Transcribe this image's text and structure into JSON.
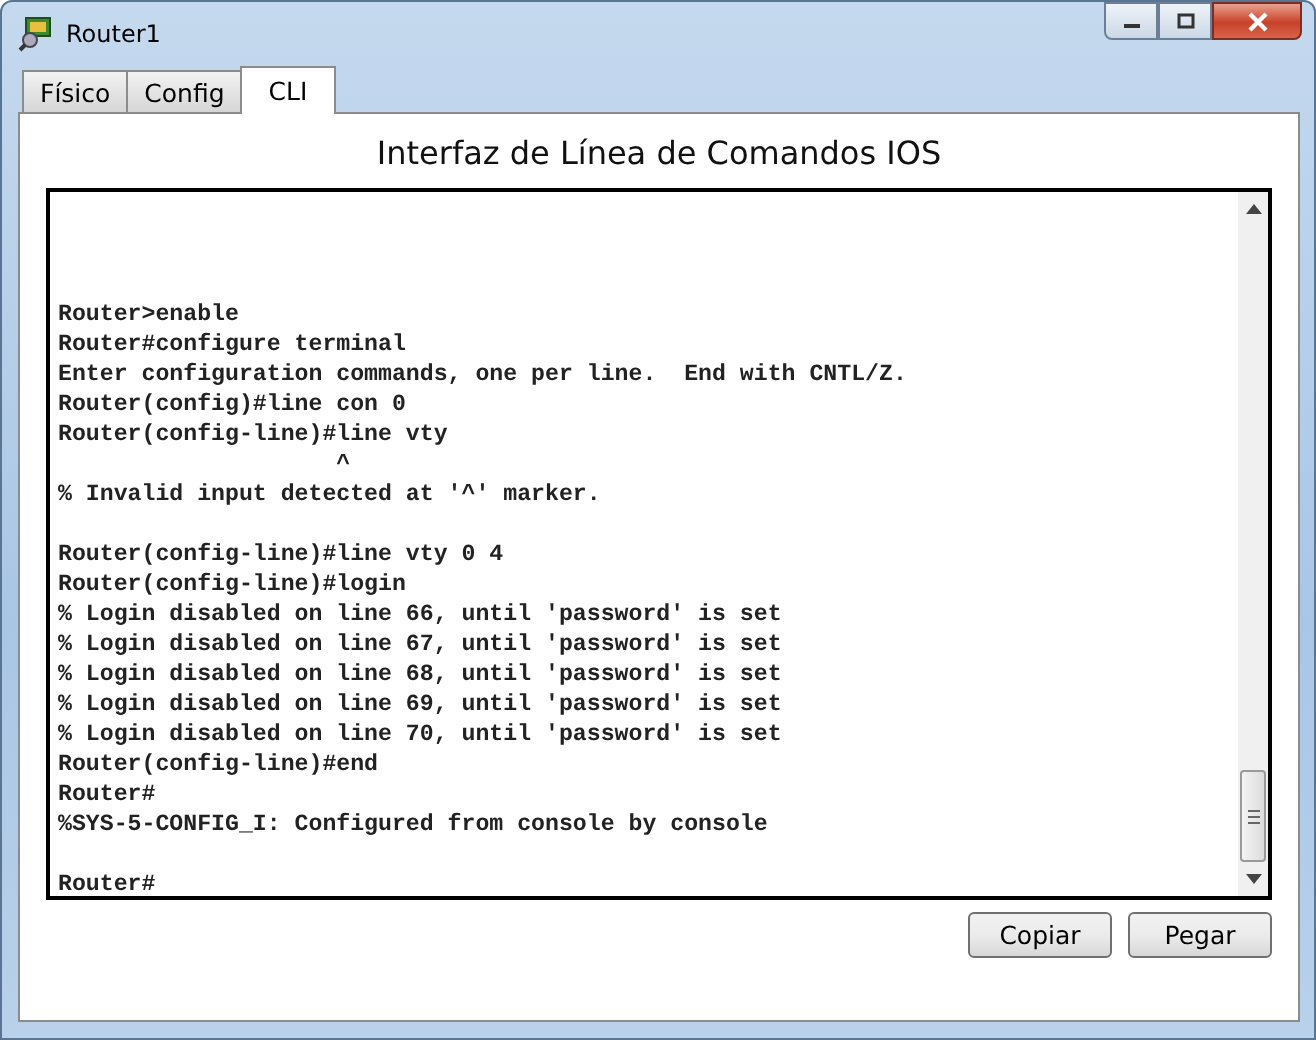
{
  "window": {
    "title": "Router1"
  },
  "tabs": [
    {
      "label": "Físico",
      "selected": false
    },
    {
      "label": "Config",
      "selected": false
    },
    {
      "label": "CLI",
      "selected": true
    }
  ],
  "heading": "Interfaz de Línea de Comandos IOS",
  "terminal": {
    "blocks": [
      [
        "Router>enable",
        "Router#configure terminal",
        "Enter configuration commands, one per line.  End with CNTL/Z.",
        "Router(config)#line con 0",
        "Router(config-line)#line vty",
        "                    ^",
        "% Invalid input detected at '^' marker."
      ],
      [
        "Router(config-line)#line vty 0 4",
        "Router(config-line)#login",
        "% Login disabled on line 66, until 'password' is set",
        "% Login disabled on line 67, until 'password' is set",
        "% Login disabled on line 68, until 'password' is set",
        "% Login disabled on line 69, until 'password' is set",
        "% Login disabled on line 70, until 'password' is set",
        "Router(config-line)#end",
        "Router#",
        "%SYS-5-CONFIG_I: Configured from console by console"
      ],
      [
        "Router#"
      ]
    ]
  },
  "buttons": [
    "Copiar",
    "Pegar"
  ]
}
